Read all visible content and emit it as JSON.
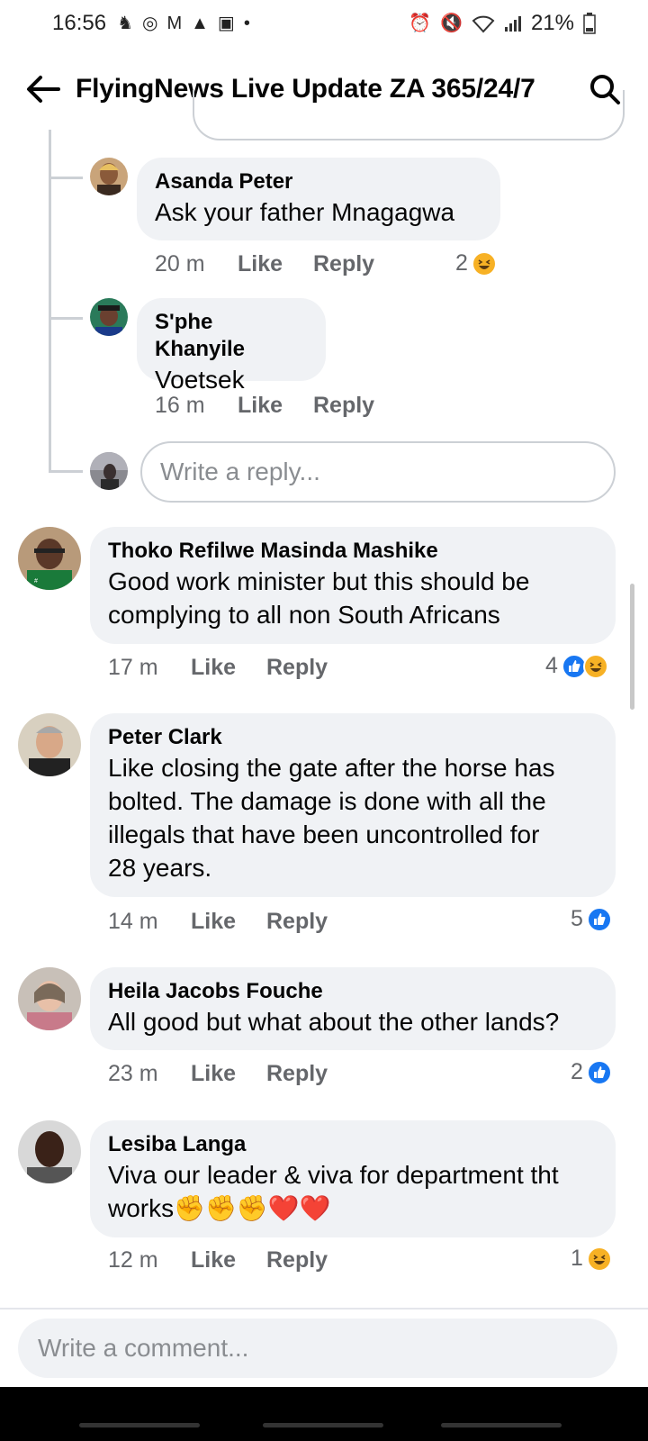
{
  "status_bar": {
    "time": "16:56",
    "battery": "21%"
  },
  "header": {
    "title": "FlyingNews Live Update ZA 365/24/7"
  },
  "replies": [
    {
      "name": "Asanda Peter",
      "text": "Ask your father Mnagagwa",
      "time": "20 m",
      "like_label": "Like",
      "reply_label": "Reply",
      "reaction_count": "2"
    },
    {
      "name": "S'phe Khanyile",
      "text": "Voetsek",
      "time": "16 m",
      "like_label": "Like",
      "reply_label": "Reply"
    }
  ],
  "reply_input": {
    "placeholder": "Write a reply..."
  },
  "comments": [
    {
      "name": "Thoko Refilwe Masinda Mashike",
      "text_lines": [
        "Good work minister but this should be",
        "complying to all non South Africans"
      ],
      "time": "17 m",
      "like_label": "Like",
      "reply_label": "Reply",
      "reaction_count": "4"
    },
    {
      "name": "Peter Clark",
      "text_lines": [
        "Like closing the gate after the horse has",
        "bolted. The damage is done with all the",
        "illegals that have been uncontrolled for",
        "28 years."
      ],
      "time": "14 m",
      "like_label": "Like",
      "reply_label": "Reply",
      "reaction_count": "5"
    },
    {
      "name": "Heila Jacobs Fouche",
      "text_lines": [
        "All good but what about the other lands?"
      ],
      "time": "23 m",
      "like_label": "Like",
      "reply_label": "Reply",
      "reaction_count": "2"
    },
    {
      "name": "Lesiba Langa",
      "text_lines": [
        "Viva our leader & viva for department tht",
        "works✊✊✊❤️❤️"
      ],
      "time": "12 m",
      "like_label": "Like",
      "reply_label": "Reply",
      "reaction_count": "1"
    }
  ],
  "comment_input": {
    "placeholder": "Write a comment..."
  },
  "colors": {
    "bubble": "#f0f2f5",
    "meta_text": "#65676b",
    "like_blue": "#1877f2",
    "haha_yellow": "#f7b125"
  }
}
